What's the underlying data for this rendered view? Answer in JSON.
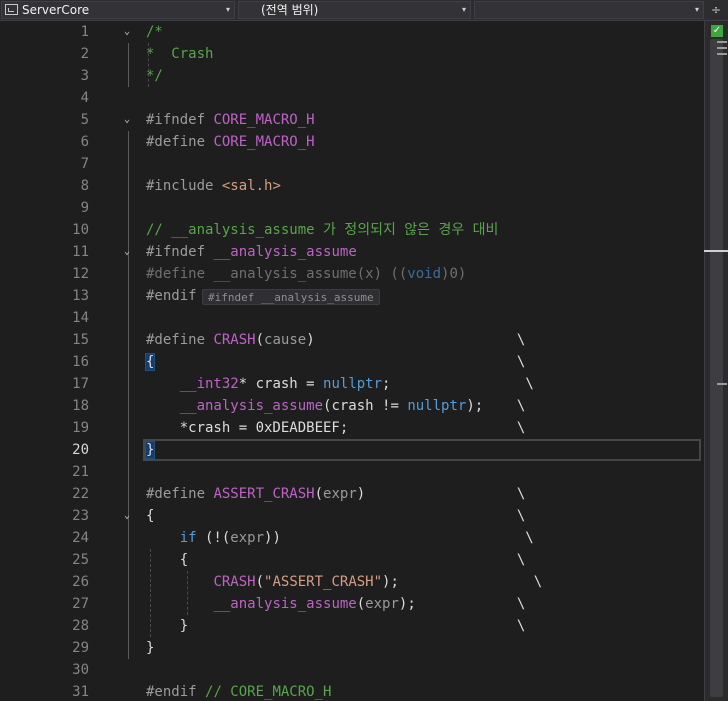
{
  "navbar": {
    "project": "ServerCore",
    "scope": "(전역 범위)",
    "member": "",
    "dropdown_arrow": "▾",
    "split_icon": "÷"
  },
  "editor": {
    "current_line": 20,
    "lines": [
      {
        "n": "1",
        "code": "<span class=\"cm\">/*</span>"
      },
      {
        "n": "2",
        "code": "<span class=\"cm\">*  Crash</span>"
      },
      {
        "n": "3",
        "code": "<span class=\"cm\">*/</span>"
      },
      {
        "n": "4",
        "code": ""
      },
      {
        "n": "5",
        "code": "<span class=\"pp\">#ifndef</span> <span class=\"mac\">CORE_MACRO_H</span>"
      },
      {
        "n": "6",
        "code": "<span class=\"pp\">#define</span> <span class=\"mac\">CORE_MACRO_H</span>"
      },
      {
        "n": "7",
        "code": ""
      },
      {
        "n": "8",
        "code": "<span class=\"pp\">#include</span> <span class=\"str\">&lt;sal.h&gt;</span>"
      },
      {
        "n": "9",
        "code": ""
      },
      {
        "n": "10",
        "code": "<span class=\"cm\">// __analysis_assume 가 정의되지 않은 경우 대비</span>"
      },
      {
        "n": "11",
        "code": "<span class=\"pp\">#ifndef</span> <span class=\"mac\">__analysis_assume</span>"
      },
      {
        "n": "12",
        "code": "<span style=\"color:#6f6f6f\">#define __analysis_assume(x) ((</span><span style=\"color:#3b6d9e\">void</span><span style=\"color:#6f6f6f\">)0)</span>"
      },
      {
        "n": "13",
        "code": "<span class=\"pp\">#endif</span>"
      },
      {
        "n": "14",
        "code": ""
      },
      {
        "n": "15",
        "code": "<span class=\"pp\">#define</span> <span class=\"mac\">CRASH</span>(<span class=\"pa\">cause</span>)                        \\"
      },
      {
        "n": "16",
        "code": "<span class=\"brace-hl\">{</span>                                           \\"
      },
      {
        "n": "17",
        "code": "    <span class=\"mac\">__int32</span>* crash = <span class=\"kw\">nullptr</span>;                \\"
      },
      {
        "n": "18",
        "code": "    <span class=\"mac\">__analysis_assume</span>(crash != <span class=\"kw\">nullptr</span>);    \\"
      },
      {
        "n": "19",
        "code": "    *crash = 0xDEADBEEF;                    \\"
      },
      {
        "n": "20",
        "code": "<span class=\"brace-hl\">}</span>"
      },
      {
        "n": "21",
        "code": ""
      },
      {
        "n": "22",
        "code": "<span class=\"pp\">#define</span> <span class=\"mac\">ASSERT_CRASH</span>(<span class=\"pa\">expr</span>)                  \\"
      },
      {
        "n": "23",
        "code": "{                                           \\"
      },
      {
        "n": "24",
        "code": "    <span class=\"kw\">if</span> (!(<span class=\"pa\">expr</span>))                             \\"
      },
      {
        "n": "25",
        "code": "    {                                       \\"
      },
      {
        "n": "26",
        "code": "        <span class=\"mac\">CRASH</span>(<span class=\"str\">\"ASSERT_CRASH\"</span>);                \\"
      },
      {
        "n": "27",
        "code": "        <span class=\"mac\">__analysis_assume</span>(<span class=\"pa\">expr</span>);            \\"
      },
      {
        "n": "28",
        "code": "    }                                       \\"
      },
      {
        "n": "29",
        "code": "}"
      },
      {
        "n": "30",
        "code": ""
      },
      {
        "n": "31",
        "code": "<span class=\"pp\">#endif</span> <span class=\"cm\">// CORE_MACRO_H</span>"
      }
    ],
    "folds": {
      "1": "⌄",
      "5": "⌄",
      "11": "⌄",
      "23": "⌄"
    },
    "hints": {
      "13": "#ifndef __analysis_assume"
    }
  },
  "status": {
    "no_issues_icon": "✓"
  }
}
